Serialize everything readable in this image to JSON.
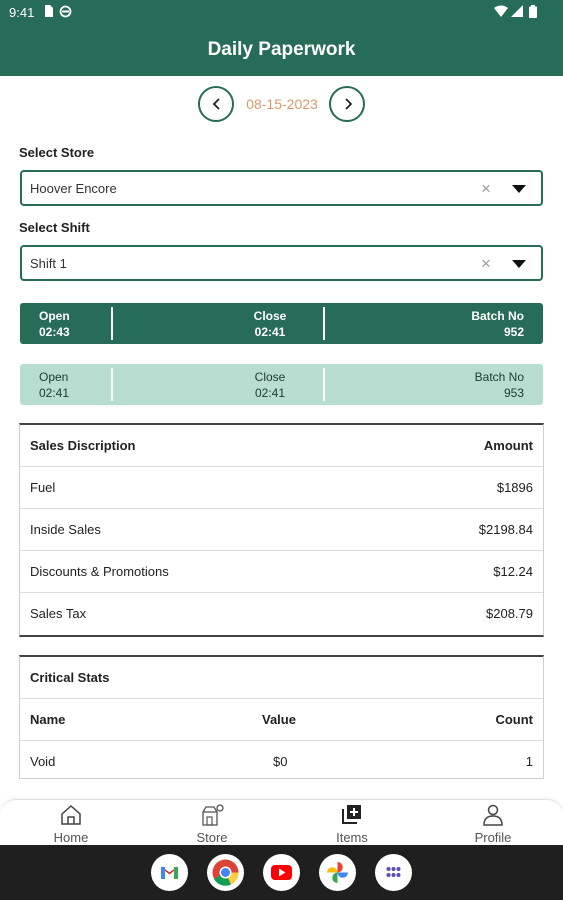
{
  "status_bar": {
    "time": "9:41"
  },
  "app_bar": {
    "title": "Daily Paperwork"
  },
  "date_nav": {
    "date": "08-15-2023"
  },
  "store_select": {
    "label": "Select Store",
    "value": "Hoover Encore"
  },
  "shift_select": {
    "label": "Select Shift",
    "value": "Shift 1"
  },
  "batches": [
    {
      "open_label": "Open",
      "open_value": "02:43",
      "close_label": "Close",
      "close_value": "02:41",
      "batch_label": "Batch No",
      "batch_value": "952"
    },
    {
      "open_label": "Open",
      "open_value": "02:41",
      "close_label": "Close",
      "close_value": "02:41",
      "batch_label": "Batch No",
      "batch_value": "953"
    }
  ],
  "sales_table": {
    "header": {
      "description": "Sales Discription",
      "amount": "Amount"
    },
    "rows": [
      {
        "description": "Fuel",
        "amount": "$1896"
      },
      {
        "description": "Inside Sales",
        "amount": "$2198.84"
      },
      {
        "description": "Discounts & Promotions",
        "amount": "$12.24"
      },
      {
        "description": "Sales Tax",
        "amount": "$208.79"
      }
    ]
  },
  "critical_stats": {
    "title": "Critical Stats",
    "columns": {
      "name": "Name",
      "value": "Value",
      "count": "Count"
    },
    "rows": [
      {
        "name": "Void",
        "value": "$0",
        "count": "1"
      }
    ]
  },
  "bottom_nav": {
    "items": [
      {
        "label": "Home",
        "icon": "home-icon"
      },
      {
        "label": "Store",
        "icon": "store-icon"
      },
      {
        "label": "Items",
        "icon": "items-icon"
      },
      {
        "label": "Profile",
        "icon": "profile-icon"
      }
    ]
  },
  "dock_apps": [
    "gmail-icon",
    "chrome-icon",
    "youtube-icon",
    "photos-icon",
    "app-drawer-icon"
  ],
  "colors": {
    "primary": "#276c57",
    "primary_light": "#b8ded2",
    "date_accent": "#d79a6c"
  }
}
